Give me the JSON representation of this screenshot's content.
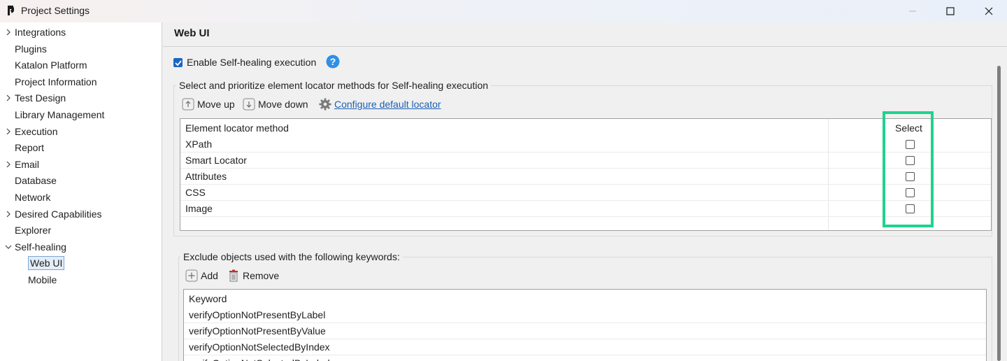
{
  "window": {
    "title": "Project Settings"
  },
  "tree": {
    "items": [
      {
        "label": "Integrations",
        "expandable": true,
        "expanded": false
      },
      {
        "label": "Plugins",
        "expandable": false
      },
      {
        "label": "Katalon Platform",
        "expandable": false
      },
      {
        "label": "Project Information",
        "expandable": false
      },
      {
        "label": "Test Design",
        "expandable": true,
        "expanded": false
      },
      {
        "label": "Library Management",
        "expandable": false
      },
      {
        "label": "Execution",
        "expandable": true,
        "expanded": false
      },
      {
        "label": "Report",
        "expandable": false
      },
      {
        "label": "Email",
        "expandable": true,
        "expanded": false
      },
      {
        "label": "Database",
        "expandable": false
      },
      {
        "label": "Network",
        "expandable": false
      },
      {
        "label": "Desired Capabilities",
        "expandable": true,
        "expanded": false
      },
      {
        "label": "Explorer",
        "expandable": false
      },
      {
        "label": "Self-healing",
        "expandable": true,
        "expanded": true
      },
      {
        "label": "Web UI",
        "expandable": false,
        "selected": true,
        "child": true
      },
      {
        "label": "Mobile",
        "expandable": false,
        "child": true
      }
    ]
  },
  "panel": {
    "title": "Web UI",
    "enable_label": "Enable Self-healing execution",
    "enable_checked": true,
    "locator_group": {
      "title": "Select and prioritize element locator methods for Self-healing execution",
      "move_up": "Move up",
      "move_down": "Move down",
      "configure": "Configure default locator",
      "header_method": "Element locator method",
      "header_select": "Select",
      "rows": [
        {
          "method": "XPath",
          "selected": false
        },
        {
          "method": "Smart Locator",
          "selected": false
        },
        {
          "method": "Attributes",
          "selected": false
        },
        {
          "method": "CSS",
          "selected": false
        },
        {
          "method": "Image",
          "selected": false
        }
      ]
    },
    "exclude_group": {
      "title": "Exclude objects used with the following keywords:",
      "add": "Add",
      "remove": "Remove",
      "header_keyword": "Keyword",
      "rows": [
        "verifyOptionNotPresentByLabel",
        "verifyOptionNotPresentByValue",
        "verifyOptionNotSelectedByIndex",
        "verifyOptionNotSelectedByLabel"
      ]
    }
  },
  "colors": {
    "highlight": "#1ed38f",
    "accent": "#1a66c2",
    "link": "#1a5fb4"
  }
}
